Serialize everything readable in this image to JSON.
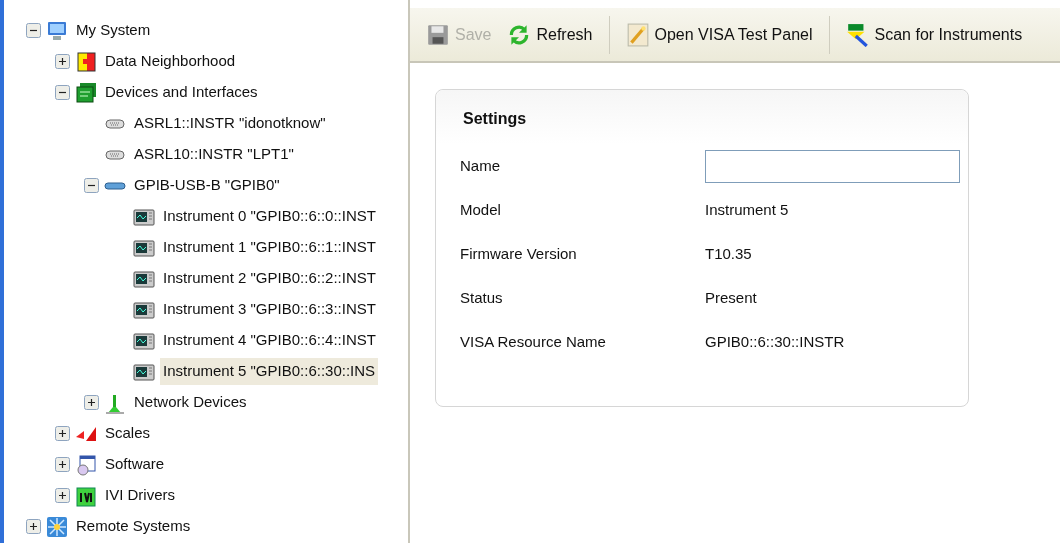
{
  "tree": [
    {
      "label": "My System",
      "kind": "computer",
      "expanded": true,
      "selected": false,
      "children": [
        {
          "label": "Data Neighborhood",
          "kind": "data",
          "expanded": false,
          "selected": false
        },
        {
          "label": "Devices and Interfaces",
          "kind": "devices",
          "expanded": true,
          "selected": false,
          "children": [
            {
              "label": "ASRL1::INSTR \"idonotknow\"",
              "kind": "serial",
              "selected": false
            },
            {
              "label": "ASRL10::INSTR \"LPT1\"",
              "kind": "serial",
              "selected": false
            },
            {
              "label": "GPIB-USB-B \"GPIB0\"",
              "kind": "gpib",
              "expanded": true,
              "selected": false,
              "children": [
                {
                  "label": "Instrument 0 \"GPIB0::6::0::INST",
                  "kind": "instrument",
                  "selected": false
                },
                {
                  "label": "Instrument 1 \"GPIB0::6::1::INST",
                  "kind": "instrument",
                  "selected": false
                },
                {
                  "label": "Instrument 2 \"GPIB0::6::2::INST",
                  "kind": "instrument",
                  "selected": false
                },
                {
                  "label": "Instrument 3 \"GPIB0::6::3::INST",
                  "kind": "instrument",
                  "selected": false
                },
                {
                  "label": "Instrument 4 \"GPIB0::6::4::INST",
                  "kind": "instrument",
                  "selected": false
                },
                {
                  "label": "Instrument 5 \"GPIB0::6::30::INS",
                  "kind": "instrument",
                  "selected": true
                }
              ]
            },
            {
              "label": "Network Devices",
              "kind": "network",
              "expanded": false,
              "selected": false
            }
          ]
        },
        {
          "label": "Scales",
          "kind": "scales",
          "expanded": false,
          "selected": false
        },
        {
          "label": "Software",
          "kind": "software",
          "expanded": false,
          "selected": false
        },
        {
          "label": "IVI Drivers",
          "kind": "ivi",
          "expanded": false,
          "selected": false
        }
      ]
    },
    {
      "label": "Remote Systems",
      "kind": "remote",
      "expanded": false,
      "selected": false
    }
  ],
  "toolbar_groups": [
    {
      "buttons": [
        {
          "label": "Save",
          "kind": "save",
          "disabled": true
        },
        {
          "label": "Refresh",
          "kind": "refresh",
          "disabled": false
        }
      ]
    },
    {
      "buttons": [
        {
          "label": "Open VISA Test Panel",
          "kind": "panel",
          "disabled": false
        }
      ]
    },
    {
      "buttons": [
        {
          "label": "Scan for Instruments",
          "kind": "scan",
          "disabled": false
        }
      ]
    }
  ],
  "settings": {
    "title": "Settings",
    "fields": [
      {
        "label": "Name",
        "kind": "input"
      },
      {
        "label": "Model",
        "kind": "text",
        "value": "Instrument 5"
      },
      {
        "label": "Firmware Version",
        "kind": "text",
        "value": "T10.35"
      },
      {
        "label": "Status",
        "kind": "text",
        "value": "Present"
      },
      {
        "label": "VISA Resource Name",
        "kind": "text",
        "value": "GPIB0::6::30::INSTR"
      }
    ]
  }
}
